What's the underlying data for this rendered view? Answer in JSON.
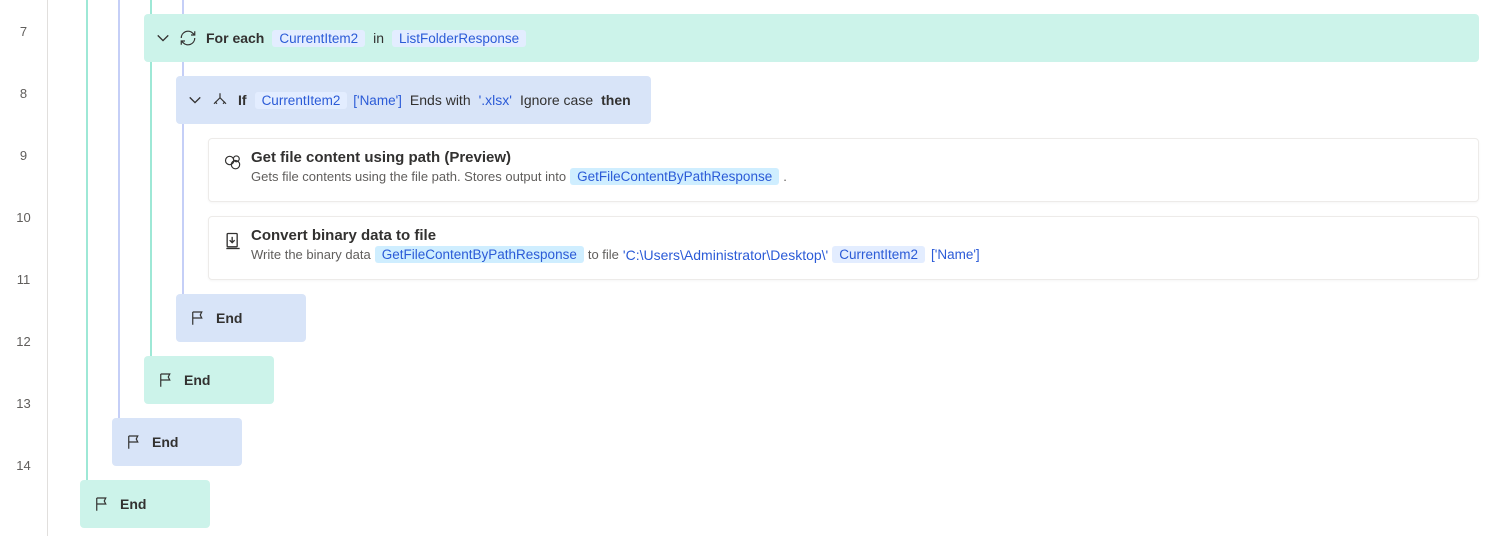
{
  "line_numbers": [
    "7",
    "8",
    "9",
    "10",
    "11",
    "12",
    "13",
    "14"
  ],
  "row7": {
    "kw_foreach": "For each",
    "var": "CurrentItem2",
    "kw_in": "in",
    "coll": "ListFolderResponse"
  },
  "row8": {
    "kw_if": "If",
    "var": "CurrentItem2",
    "prop": "['Name']",
    "op": "Ends with",
    "val": "'.xlsx'",
    "ic": "Ignore case",
    "kw_then": "then"
  },
  "row9": {
    "title": "Get file content using path (Preview)",
    "desc_pre": "Gets file contents using the file path. Stores output into",
    "token": "GetFileContentByPathResponse",
    "desc_post": "."
  },
  "row10": {
    "title": "Convert binary data to file",
    "desc_pre": "Write the binary data",
    "token1": "GetFileContentByPathResponse",
    "mid": "to file",
    "path": "'C:\\Users\\Administrator\\Desktop\\'",
    "token2": "CurrentItem2",
    "prop": "['Name']"
  },
  "end": "End"
}
